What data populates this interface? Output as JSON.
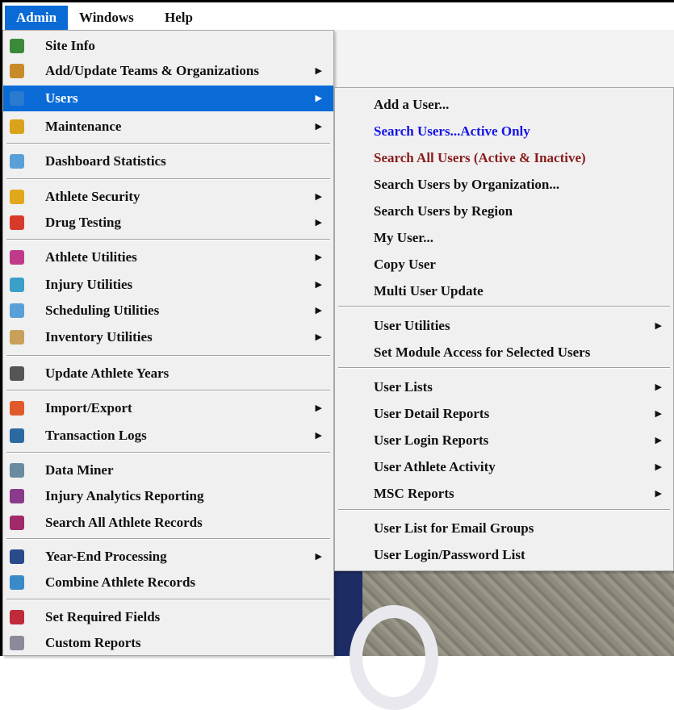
{
  "menubar": {
    "items": [
      {
        "label": "Admin",
        "active": true
      },
      {
        "label": "Windows",
        "active": false
      },
      {
        "label": "Help",
        "active": false
      }
    ]
  },
  "admin_menu": {
    "items": [
      {
        "label": "Site Info",
        "icon": "site-info-icon",
        "color": "#3a8a3a",
        "submenu": false
      },
      {
        "label": "Add/Update Teams & Organizations",
        "icon": "teams-icon",
        "color": "#c98a2a",
        "submenu": true
      },
      {
        "label": "Users",
        "icon": "users-icon",
        "color": "#2a7ad0",
        "submenu": true,
        "highlighted": true
      },
      {
        "label": "Maintenance",
        "icon": "maintenance-icon",
        "color": "#d8a21a",
        "submenu": true
      },
      {
        "label": "Dashboard Statistics",
        "icon": "dashboard-icon",
        "color": "#5aa0d8",
        "submenu": false
      },
      {
        "label": "Athlete Security",
        "icon": "athlete-security-icon",
        "color": "#e0a81a",
        "submenu": true
      },
      {
        "label": "Drug Testing",
        "icon": "drug-testing-icon",
        "color": "#d83a2a",
        "submenu": true
      },
      {
        "label": "Athlete Utilities",
        "icon": "athlete-utilities-icon",
        "color": "#c03a8a",
        "submenu": true
      },
      {
        "label": "Injury Utilities",
        "icon": "injury-utilities-icon",
        "color": "#3aa0c8",
        "submenu": true
      },
      {
        "label": "Scheduling Utilities",
        "icon": "scheduling-icon",
        "color": "#5aa0d8",
        "submenu": true
      },
      {
        "label": "Inventory Utilities",
        "icon": "inventory-icon",
        "color": "#c8a05a",
        "submenu": true
      },
      {
        "label": "Update Athlete Years",
        "icon": "graduation-icon",
        "color": "#555555",
        "submenu": false
      },
      {
        "label": "Import/Export",
        "icon": "import-export-icon",
        "color": "#e05a2a",
        "submenu": true
      },
      {
        "label": "Transaction Logs",
        "icon": "transaction-logs-icon",
        "color": "#2a6aa0",
        "submenu": true
      },
      {
        "label": "Data Miner",
        "icon": "data-miner-icon",
        "color": "#6a8aa0",
        "submenu": false
      },
      {
        "label": "Injury Analytics Reporting",
        "icon": "injury-analytics-icon",
        "color": "#8a3a8a",
        "submenu": false
      },
      {
        "label": "Search All Athlete Records",
        "icon": "search-records-icon",
        "color": "#a02a6a",
        "submenu": false
      },
      {
        "label": "Year-End Processing",
        "icon": "year-end-icon",
        "color": "#2a4a8a",
        "submenu": true
      },
      {
        "label": "Combine Athlete Records",
        "icon": "combine-records-icon",
        "color": "#3a8ac8",
        "submenu": false
      },
      {
        "label": "Set Required Fields",
        "icon": "required-fields-icon",
        "color": "#c02a3a",
        "submenu": false
      },
      {
        "label": "Custom Reports",
        "icon": "custom-reports-icon",
        "color": "#8a8a9a",
        "submenu": false
      }
    ]
  },
  "users_submenu": {
    "items": [
      {
        "label": "Add a User...",
        "submenu": false,
        "style": "normal"
      },
      {
        "label": "Search Users...Active Only",
        "submenu": false,
        "style": "blue"
      },
      {
        "label": "Search All Users (Active & Inactive)",
        "submenu": false,
        "style": "maroon"
      },
      {
        "label": "Search Users by Organization...",
        "submenu": false,
        "style": "normal"
      },
      {
        "label": "Search Users by Region",
        "submenu": false,
        "style": "normal"
      },
      {
        "label": "My User...",
        "submenu": false,
        "style": "normal"
      },
      {
        "label": "Copy User",
        "submenu": false,
        "style": "normal"
      },
      {
        "label": "Multi User Update",
        "submenu": false,
        "style": "normal"
      },
      {
        "label": "User Utilities",
        "submenu": true,
        "style": "normal"
      },
      {
        "label": "Set Module Access for Selected Users",
        "submenu": false,
        "style": "normal"
      },
      {
        "label": "User Lists",
        "submenu": true,
        "style": "normal"
      },
      {
        "label": "User Detail Reports",
        "submenu": true,
        "style": "normal"
      },
      {
        "label": "User Login Reports",
        "submenu": true,
        "style": "normal"
      },
      {
        "label": "User Athlete Activity",
        "submenu": true,
        "style": "normal"
      },
      {
        "label": "MSC Reports",
        "submenu": true,
        "style": "normal"
      },
      {
        "label": "User List for Email Groups",
        "submenu": false,
        "style": "normal"
      },
      {
        "label": "User Login/Password List",
        "submenu": false,
        "style": "normal"
      }
    ]
  },
  "arrow_glyph": "▶"
}
